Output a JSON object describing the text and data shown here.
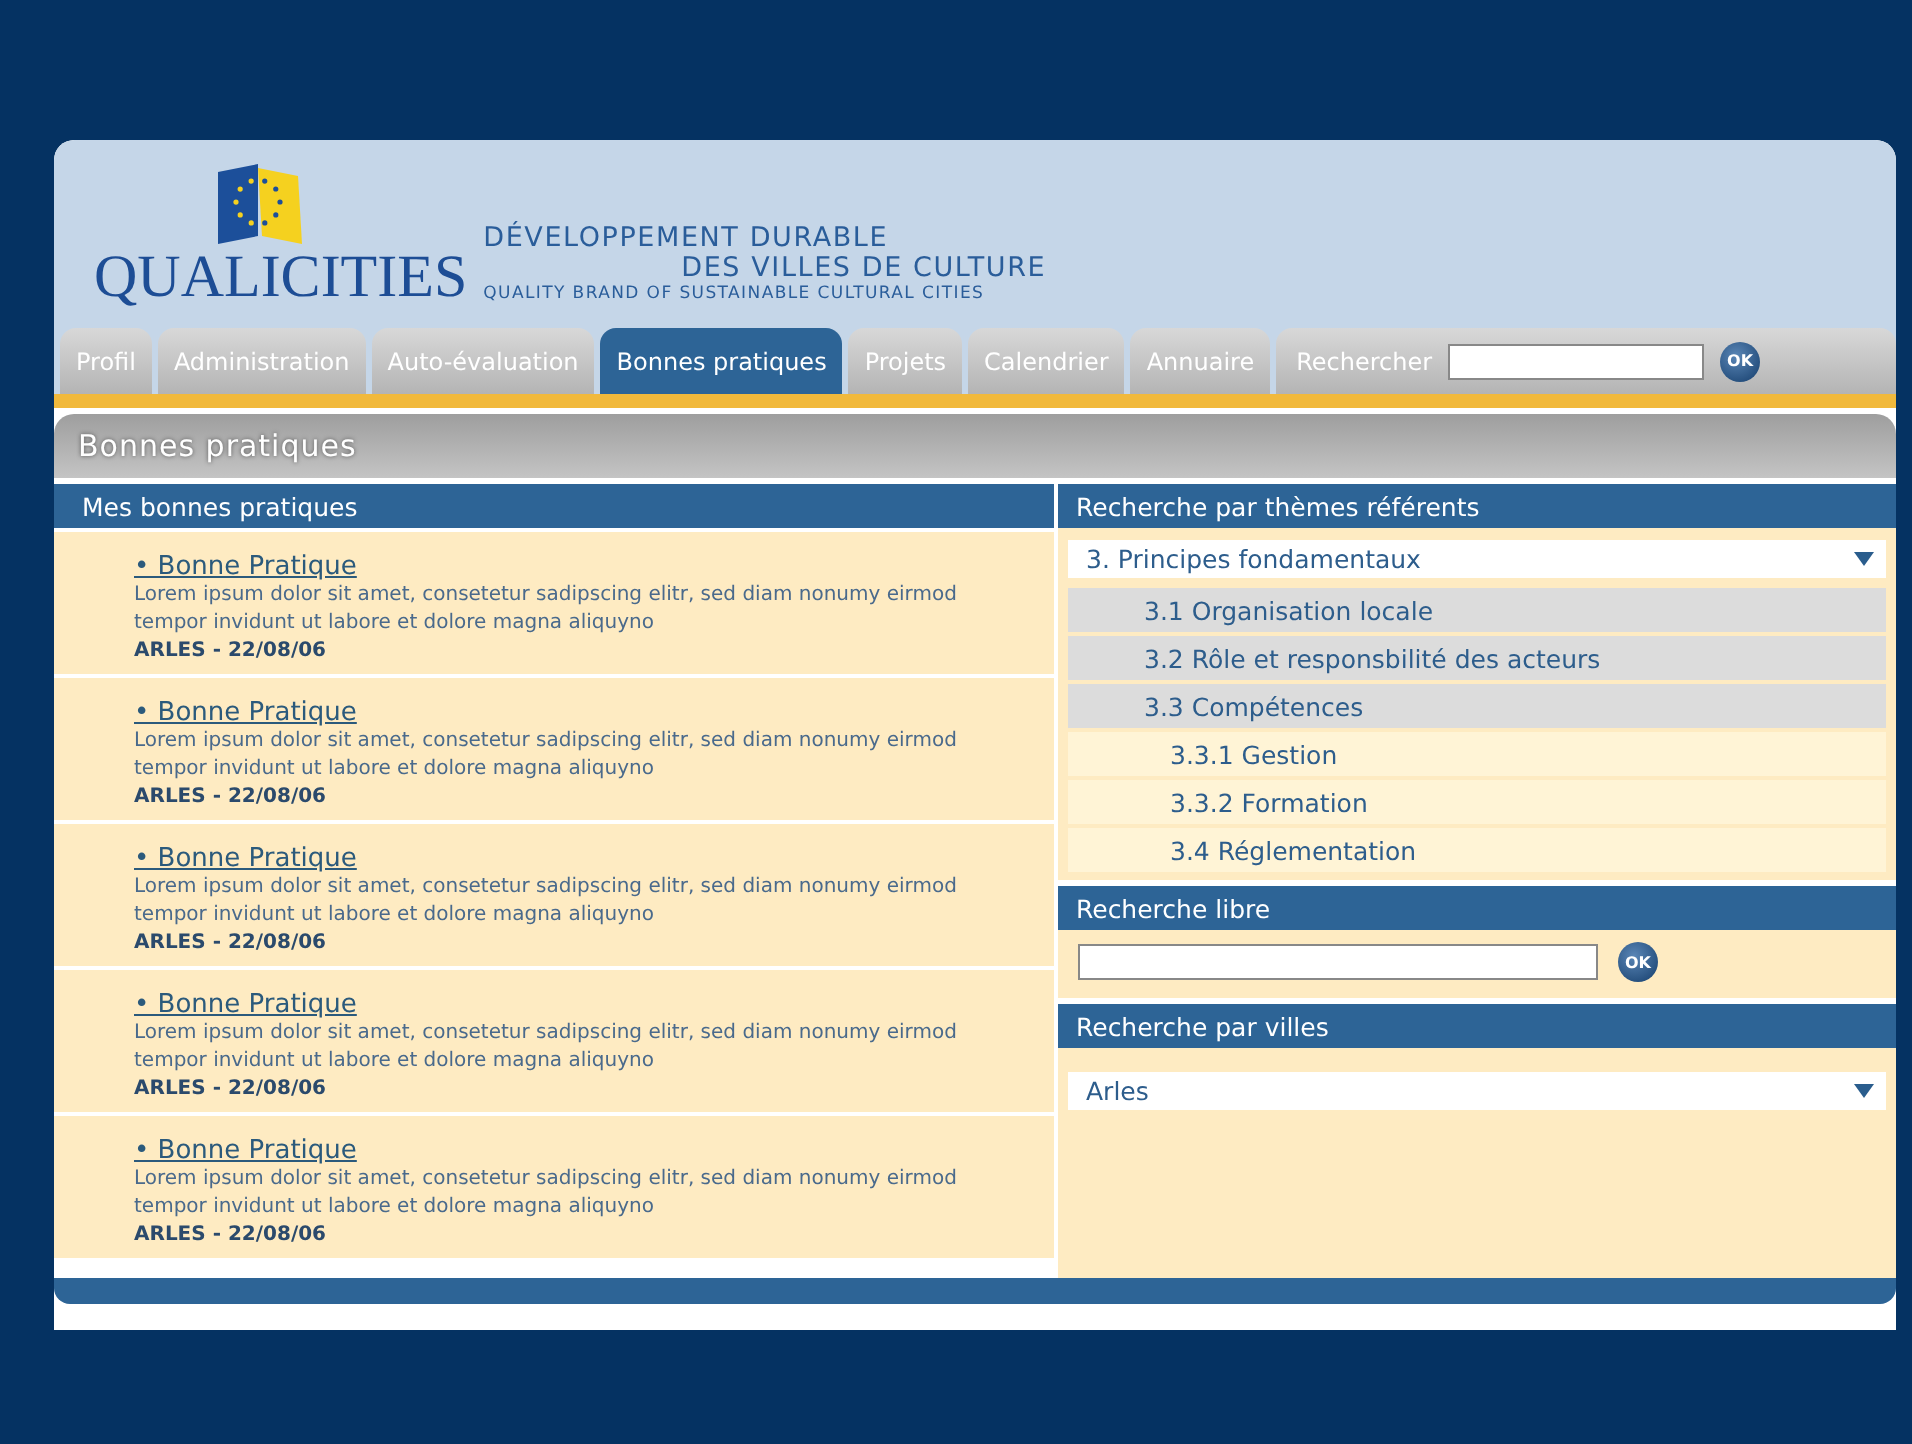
{
  "header": {
    "logo_text": "QUALICITIES",
    "tagline_1": "DÉVELOPPEMENT DURABLE",
    "tagline_2": "DES VILLES DE CULTURE",
    "tagline_3": "QUALITY BRAND OF SUSTAINABLE CULTURAL CITIES"
  },
  "tabs": [
    {
      "label": "Profil",
      "selected": false
    },
    {
      "label": "Administration",
      "selected": false
    },
    {
      "label": "Auto-évaluation",
      "selected": false
    },
    {
      "label": "Bonnes pratiques",
      "selected": true
    },
    {
      "label": "Projets",
      "selected": false
    },
    {
      "label": "Calendrier",
      "selected": false
    },
    {
      "label": "Annuaire",
      "selected": false
    }
  ],
  "top_search": {
    "label": "Rechercher",
    "button": "OK"
  },
  "page_title": "Bonnes pratiques",
  "practices": {
    "title": "Mes bonnes pratiques",
    "items": [
      {
        "title": "• Bonne Pratique",
        "text": "Lorem ipsum dolor sit amet, consetetur sadipscing elitr, sed diam nonumy eirmod tempor invidunt ut labore et dolore magna aliquyno",
        "meta": "ARLES - 22/08/06"
      },
      {
        "title": "• Bonne Pratique",
        "text": "Lorem ipsum dolor sit amet, consetetur sadipscing elitr, sed diam nonumy eirmod tempor invidunt ut labore et dolore magna aliquyno",
        "meta": "ARLES - 22/08/06"
      },
      {
        "title": "• Bonne Pratique",
        "text": "Lorem ipsum dolor sit amet, consetetur sadipscing elitr, sed diam nonumy eirmod tempor invidunt ut labore et dolore magna aliquyno",
        "meta": "ARLES - 22/08/06"
      },
      {
        "title": "• Bonne Pratique",
        "text": "Lorem ipsum dolor sit amet, consetetur sadipscing elitr, sed diam nonumy eirmod tempor invidunt ut labore et dolore magna aliquyno",
        "meta": "ARLES - 22/08/06"
      },
      {
        "title": "• Bonne Pratique",
        "text": "Lorem ipsum dolor sit amet, consetetur sadipscing elitr, sed diam nonumy eirmod tempor invidunt ut labore et dolore magna aliquyno",
        "meta": "ARLES - 22/08/06"
      }
    ]
  },
  "themes": {
    "title": "Recherche par thèmes référents",
    "select_value": "3. Principes fondamentaux",
    "items": [
      {
        "label": "3.1 Organisation locale"
      },
      {
        "label": "3.2 Rôle et responsbilité des acteurs"
      },
      {
        "label": "3.3 Compétences",
        "children": [
          {
            "label": "3.3.1 Gestion"
          },
          {
            "label": "3.3.2 Formation"
          },
          {
            "label": "3.4 Réglementation"
          }
        ]
      }
    ]
  },
  "free_search": {
    "title": "Recherche libre",
    "button": "OK"
  },
  "cities": {
    "title": "Recherche par villes",
    "select_value": "Arles"
  }
}
